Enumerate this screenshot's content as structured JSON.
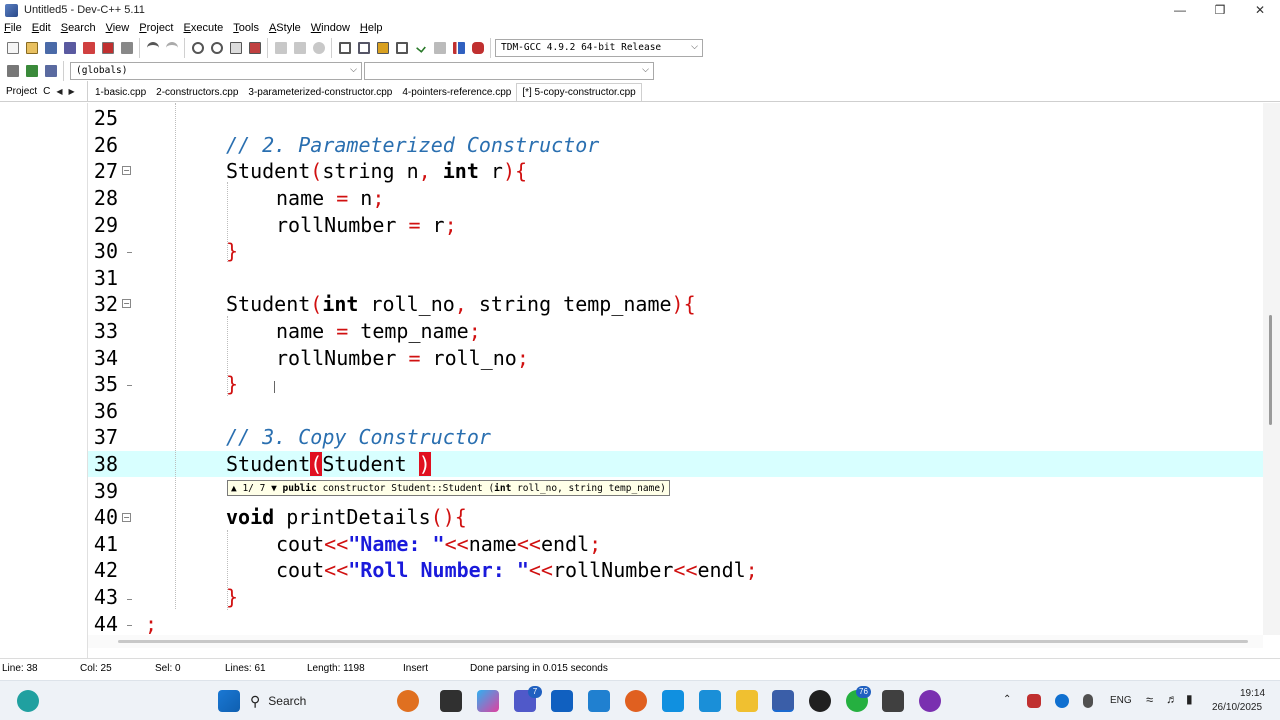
{
  "window": {
    "title": "Untitled5 - Dev-C++ 5.11",
    "minimize": "—",
    "maximize": "❒",
    "close": "✕"
  },
  "menu": [
    "File",
    "Edit",
    "Search",
    "View",
    "Project",
    "Execute",
    "Tools",
    "AStyle",
    "Window",
    "Help"
  ],
  "toolbar": {
    "compiler": "TDM-GCC 4.9.2 64-bit Release",
    "scope": "(globals)",
    "members": ""
  },
  "tabs": {
    "project_tab": "Project",
    "project_tab_2": "C",
    "files": [
      "1-basic.cpp",
      "2-constructors.cpp",
      "3-parameterized-constructor.cpp",
      "4-pointers-reference.cpp",
      "[*] 5-copy-constructor.cpp"
    ],
    "active_index": 4
  },
  "code": {
    "current_line": 38,
    "lines": [
      {
        "n": "25",
        "t": ""
      },
      {
        "n": "26",
        "t": "// 2. Parameterized Constructor"
      },
      {
        "n": "27",
        "t": "Student(string n, int r){"
      },
      {
        "n": "28",
        "t": "name = n;"
      },
      {
        "n": "29",
        "t": "rollNumber = r;"
      },
      {
        "n": "30",
        "t": "}"
      },
      {
        "n": "31",
        "t": ""
      },
      {
        "n": "32",
        "t": "Student(int roll_no, string temp_name){"
      },
      {
        "n": "33",
        "t": "name = temp_name;"
      },
      {
        "n": "34",
        "t": "rollNumber = roll_no;"
      },
      {
        "n": "35",
        "t": "}"
      },
      {
        "n": "36",
        "t": ""
      },
      {
        "n": "37",
        "t": "// 3. Copy Constructor"
      },
      {
        "n": "38",
        "t": "Student(Student )"
      },
      {
        "n": "39",
        "t": ""
      },
      {
        "n": "40",
        "t": "void printDetails(){"
      },
      {
        "n": "41",
        "t": "cout<<\"Name: \"<<name<<endl;"
      },
      {
        "n": "42",
        "t": "cout<<\"Roll Number: \"<<rollNumber<<endl;"
      },
      {
        "n": "43",
        "t": "}"
      },
      {
        "n": "44",
        "t": ";"
      }
    ]
  },
  "tooltip": {
    "counter": "1/ 7",
    "keyword": "public",
    "text": "constructor Student::Student (",
    "param_kw": "int",
    "param_rest": "roll_no, string temp_name)"
  },
  "status": {
    "line": "Line:   38",
    "col": "Col:   25",
    "sel": "Sel:   0",
    "lines": "Lines:   61",
    "length": "Length:  1198",
    "mode": "Insert",
    "message": "Done parsing in 0.015 seconds"
  },
  "taskbar": {
    "search": "Search",
    "lang": "ENG",
    "time": "19:14",
    "date": "26/10/2025",
    "badge_teams": "7",
    "badge_whatsapp": "76"
  },
  "colors": {
    "current_line": "#d8ffff",
    "comment": "#2a6fb0",
    "string": "#1a1adb",
    "symbol": "#d01010",
    "bracket_match": "#e01020"
  }
}
